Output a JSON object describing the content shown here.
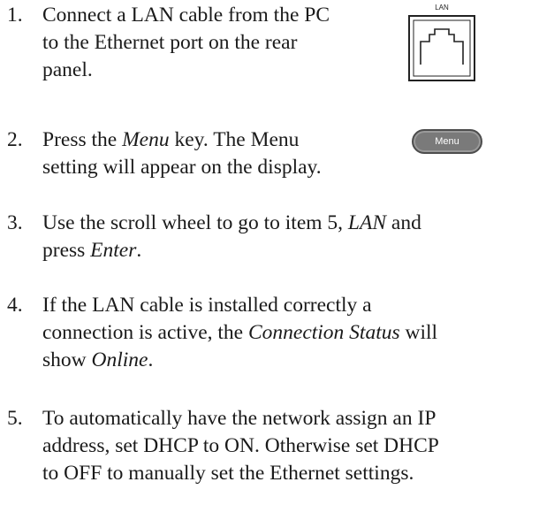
{
  "steps": [
    {
      "number": "1.",
      "lines": [
        "Connect a LAN cable from the PC",
        "to the Ethernet port on the rear",
        "panel."
      ]
    },
    {
      "number": "2.",
      "line1_a": "Press the ",
      "line1_em": "Menu",
      "line1_b": " key. The Menu",
      "line2": "setting will appear on the display."
    },
    {
      "number": "3.",
      "line1_a": "Use the scroll wheel to go to item 5, ",
      "line1_em": "LAN",
      "line1_b": " and",
      "line2_a": "press ",
      "line2_em": "Enter",
      "line2_b": "."
    },
    {
      "number": "4.",
      "line1": "If the LAN cable is installed correctly a",
      "line2_a": "connection is active, the ",
      "line2_em": "Connection Status",
      "line2_b": " will",
      "line3_a": "show ",
      "line3_em": "Online",
      "line3_b": "."
    },
    {
      "number": "5.",
      "lines": [
        "To automatically have the network assign an IP",
        "address, set DHCP to ON. Otherwise set DHCP",
        "to OFF to manually set the Ethernet settings."
      ]
    }
  ],
  "figures": {
    "lan_port": {
      "label": "LAN",
      "icon": "ethernet-port-icon"
    },
    "menu_key": {
      "label": "Menu",
      "color": "#7a7a7a"
    }
  }
}
